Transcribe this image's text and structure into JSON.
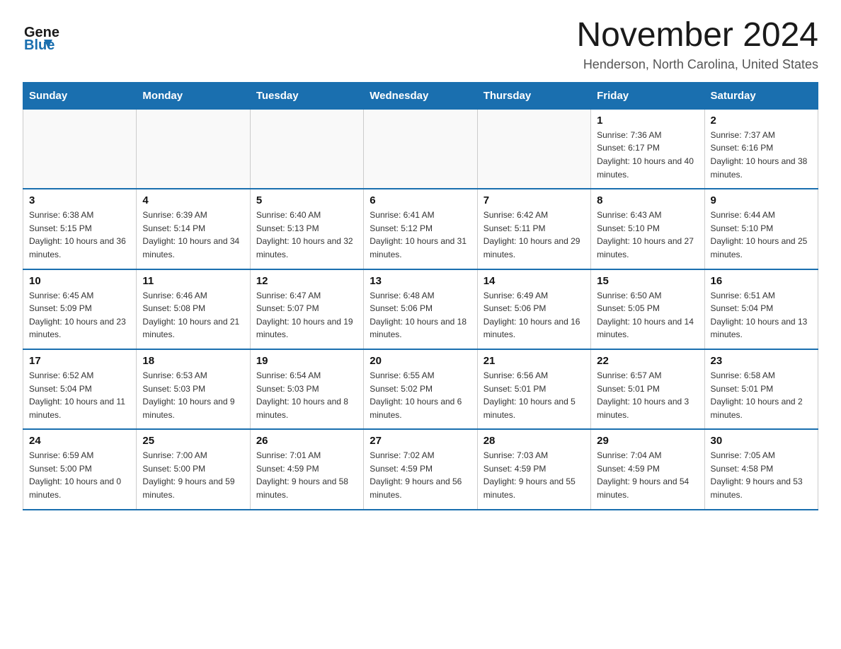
{
  "logo": {
    "general": "General",
    "blue": "Blue"
  },
  "header": {
    "month_year": "November 2024",
    "location": "Henderson, North Carolina, United States"
  },
  "weekdays": [
    "Sunday",
    "Monday",
    "Tuesday",
    "Wednesday",
    "Thursday",
    "Friday",
    "Saturday"
  ],
  "weeks": [
    [
      {
        "day": "",
        "info": ""
      },
      {
        "day": "",
        "info": ""
      },
      {
        "day": "",
        "info": ""
      },
      {
        "day": "",
        "info": ""
      },
      {
        "day": "",
        "info": ""
      },
      {
        "day": "1",
        "info": "Sunrise: 7:36 AM\nSunset: 6:17 PM\nDaylight: 10 hours and 40 minutes."
      },
      {
        "day": "2",
        "info": "Sunrise: 7:37 AM\nSunset: 6:16 PM\nDaylight: 10 hours and 38 minutes."
      }
    ],
    [
      {
        "day": "3",
        "info": "Sunrise: 6:38 AM\nSunset: 5:15 PM\nDaylight: 10 hours and 36 minutes."
      },
      {
        "day": "4",
        "info": "Sunrise: 6:39 AM\nSunset: 5:14 PM\nDaylight: 10 hours and 34 minutes."
      },
      {
        "day": "5",
        "info": "Sunrise: 6:40 AM\nSunset: 5:13 PM\nDaylight: 10 hours and 32 minutes."
      },
      {
        "day": "6",
        "info": "Sunrise: 6:41 AM\nSunset: 5:12 PM\nDaylight: 10 hours and 31 minutes."
      },
      {
        "day": "7",
        "info": "Sunrise: 6:42 AM\nSunset: 5:11 PM\nDaylight: 10 hours and 29 minutes."
      },
      {
        "day": "8",
        "info": "Sunrise: 6:43 AM\nSunset: 5:10 PM\nDaylight: 10 hours and 27 minutes."
      },
      {
        "day": "9",
        "info": "Sunrise: 6:44 AM\nSunset: 5:10 PM\nDaylight: 10 hours and 25 minutes."
      }
    ],
    [
      {
        "day": "10",
        "info": "Sunrise: 6:45 AM\nSunset: 5:09 PM\nDaylight: 10 hours and 23 minutes."
      },
      {
        "day": "11",
        "info": "Sunrise: 6:46 AM\nSunset: 5:08 PM\nDaylight: 10 hours and 21 minutes."
      },
      {
        "day": "12",
        "info": "Sunrise: 6:47 AM\nSunset: 5:07 PM\nDaylight: 10 hours and 19 minutes."
      },
      {
        "day": "13",
        "info": "Sunrise: 6:48 AM\nSunset: 5:06 PM\nDaylight: 10 hours and 18 minutes."
      },
      {
        "day": "14",
        "info": "Sunrise: 6:49 AM\nSunset: 5:06 PM\nDaylight: 10 hours and 16 minutes."
      },
      {
        "day": "15",
        "info": "Sunrise: 6:50 AM\nSunset: 5:05 PM\nDaylight: 10 hours and 14 minutes."
      },
      {
        "day": "16",
        "info": "Sunrise: 6:51 AM\nSunset: 5:04 PM\nDaylight: 10 hours and 13 minutes."
      }
    ],
    [
      {
        "day": "17",
        "info": "Sunrise: 6:52 AM\nSunset: 5:04 PM\nDaylight: 10 hours and 11 minutes."
      },
      {
        "day": "18",
        "info": "Sunrise: 6:53 AM\nSunset: 5:03 PM\nDaylight: 10 hours and 9 minutes."
      },
      {
        "day": "19",
        "info": "Sunrise: 6:54 AM\nSunset: 5:03 PM\nDaylight: 10 hours and 8 minutes."
      },
      {
        "day": "20",
        "info": "Sunrise: 6:55 AM\nSunset: 5:02 PM\nDaylight: 10 hours and 6 minutes."
      },
      {
        "day": "21",
        "info": "Sunrise: 6:56 AM\nSunset: 5:01 PM\nDaylight: 10 hours and 5 minutes."
      },
      {
        "day": "22",
        "info": "Sunrise: 6:57 AM\nSunset: 5:01 PM\nDaylight: 10 hours and 3 minutes."
      },
      {
        "day": "23",
        "info": "Sunrise: 6:58 AM\nSunset: 5:01 PM\nDaylight: 10 hours and 2 minutes."
      }
    ],
    [
      {
        "day": "24",
        "info": "Sunrise: 6:59 AM\nSunset: 5:00 PM\nDaylight: 10 hours and 0 minutes."
      },
      {
        "day": "25",
        "info": "Sunrise: 7:00 AM\nSunset: 5:00 PM\nDaylight: 9 hours and 59 minutes."
      },
      {
        "day": "26",
        "info": "Sunrise: 7:01 AM\nSunset: 4:59 PM\nDaylight: 9 hours and 58 minutes."
      },
      {
        "day": "27",
        "info": "Sunrise: 7:02 AM\nSunset: 4:59 PM\nDaylight: 9 hours and 56 minutes."
      },
      {
        "day": "28",
        "info": "Sunrise: 7:03 AM\nSunset: 4:59 PM\nDaylight: 9 hours and 55 minutes."
      },
      {
        "day": "29",
        "info": "Sunrise: 7:04 AM\nSunset: 4:59 PM\nDaylight: 9 hours and 54 minutes."
      },
      {
        "day": "30",
        "info": "Sunrise: 7:05 AM\nSunset: 4:58 PM\nDaylight: 9 hours and 53 minutes."
      }
    ]
  ]
}
